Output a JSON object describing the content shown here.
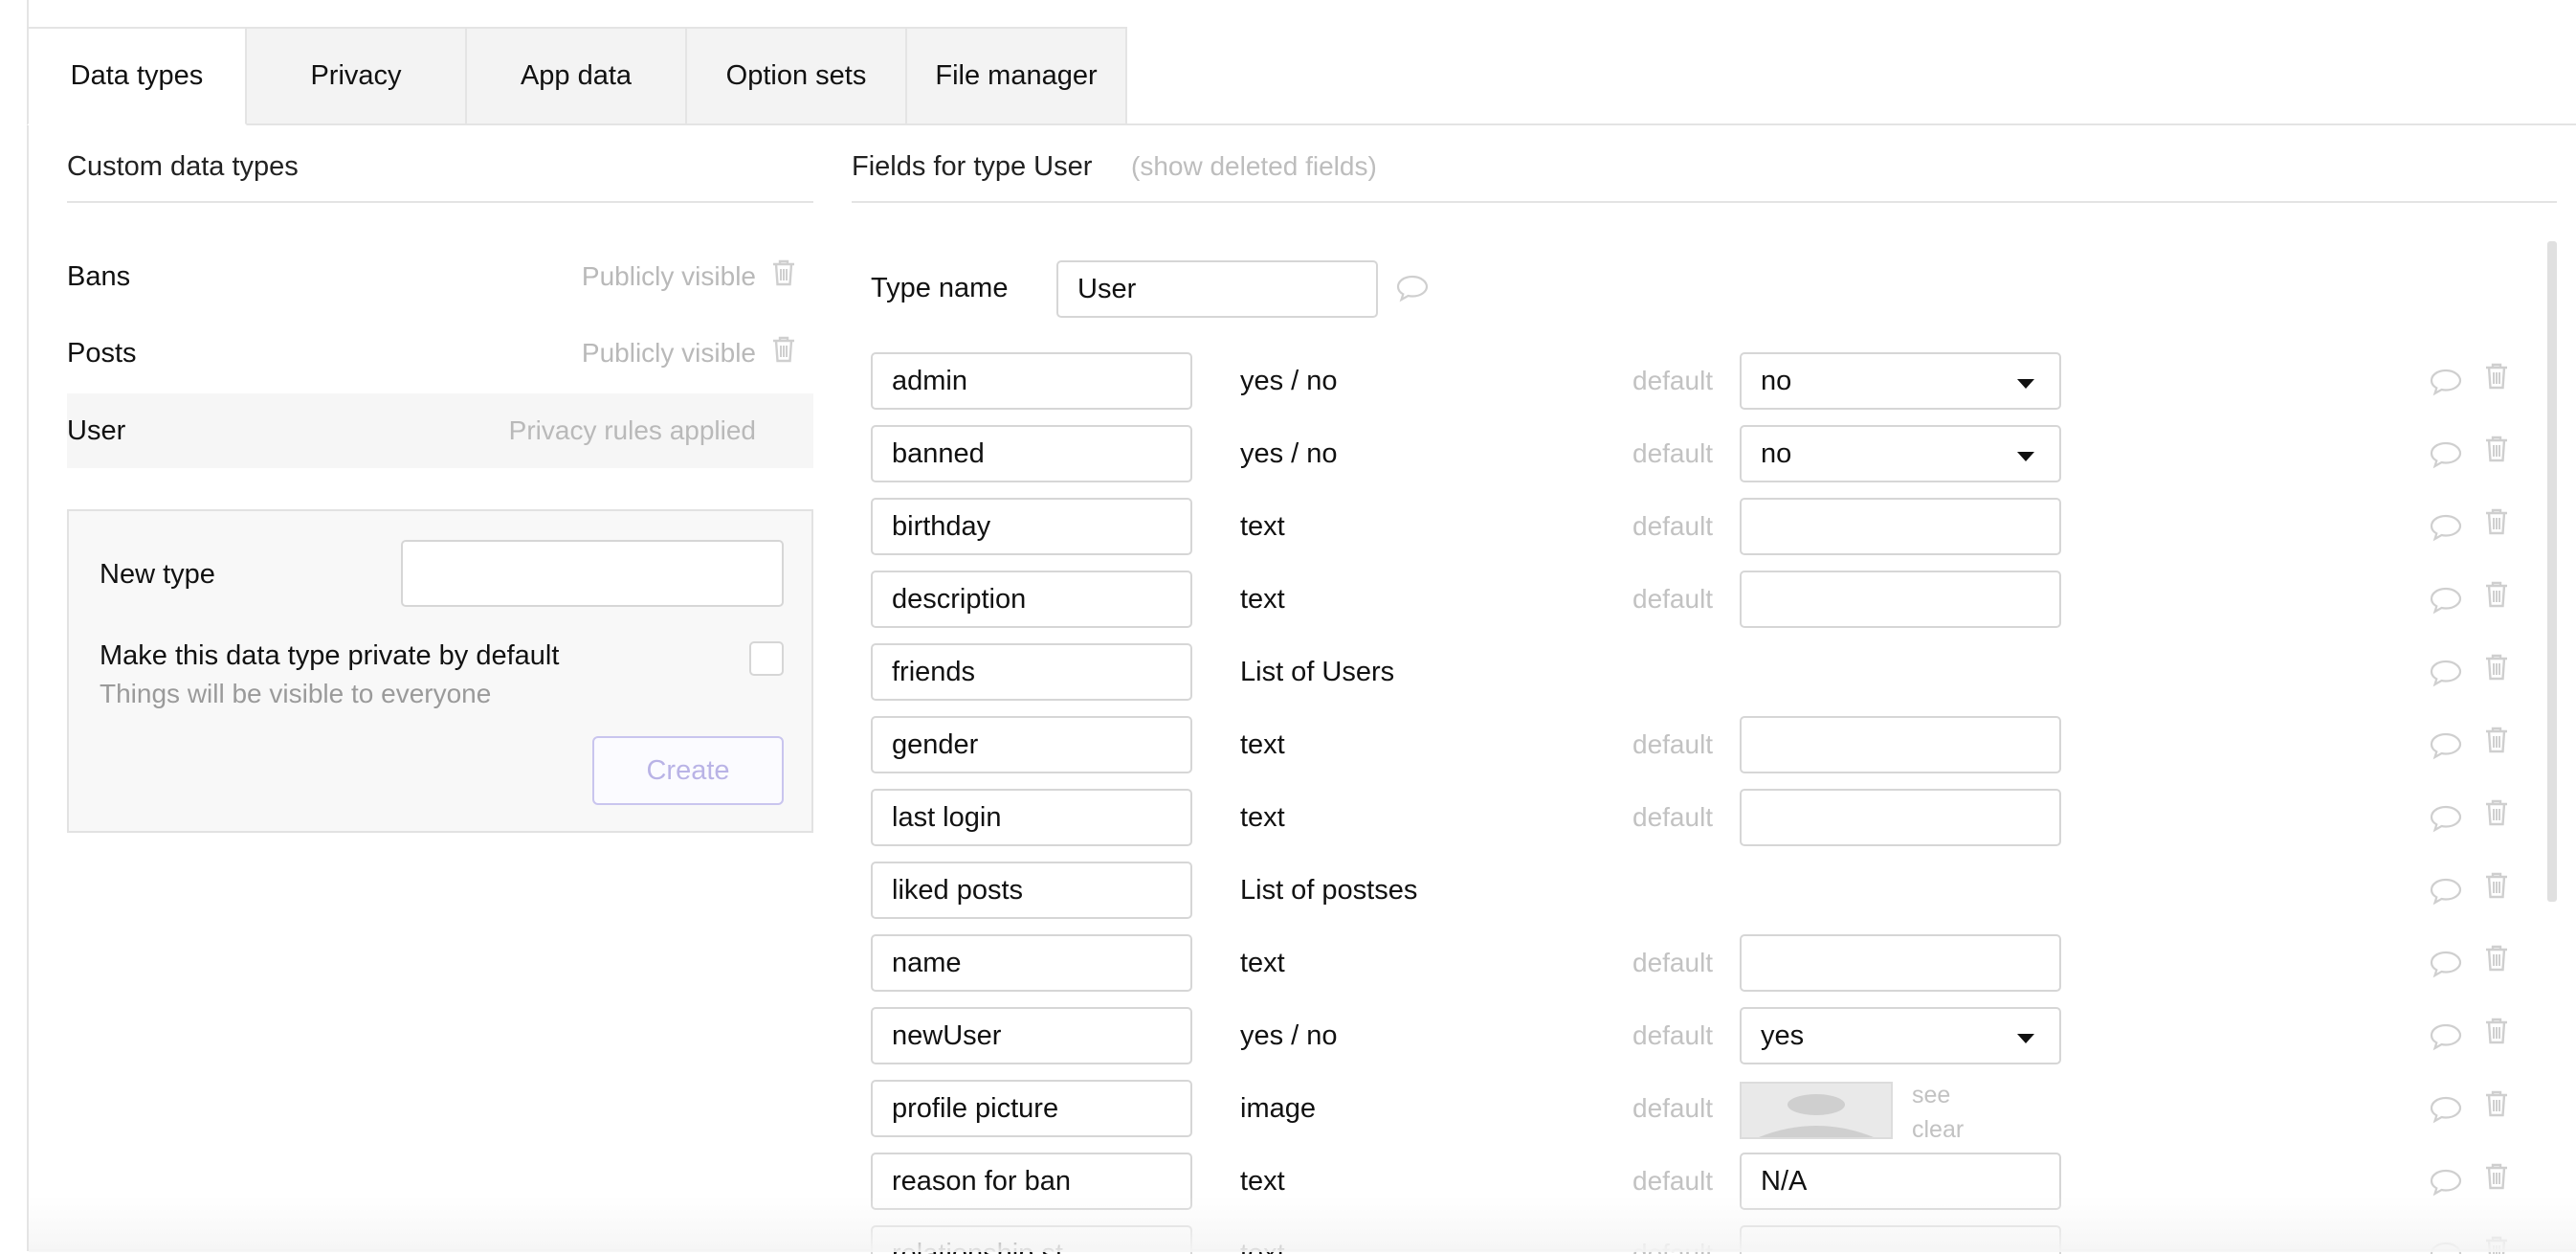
{
  "tabs": [
    "Data types",
    "Privacy",
    "App data",
    "Option sets",
    "File manager"
  ],
  "left": {
    "heading": "Custom data types",
    "types": [
      {
        "name": "Bans",
        "status": "Publicly visible",
        "deletable": true
      },
      {
        "name": "Posts",
        "status": "Publicly visible",
        "deletable": true
      },
      {
        "name": "User",
        "status": "Privacy rules applied",
        "deletable": false
      }
    ],
    "new_type": {
      "label": "New type",
      "private_label": "Make this data type private by default",
      "private_sub": "Things will be visible to everyone",
      "create_label": "Create"
    }
  },
  "right": {
    "heading": "Fields for type User",
    "show_deleted": "(show deleted fields)",
    "type_name_label": "Type name",
    "type_name_value": "User",
    "fields": [
      {
        "name": "admin",
        "type": "yes / no",
        "default_label": "default",
        "default": "no",
        "kind": "select"
      },
      {
        "name": "banned",
        "type": "yes / no",
        "default_label": "default",
        "default": "no",
        "kind": "select"
      },
      {
        "name": "birthday",
        "type": "text",
        "default_label": "default",
        "default": "",
        "kind": "text"
      },
      {
        "name": "description",
        "type": "text",
        "default_label": "default",
        "default": "",
        "kind": "text"
      },
      {
        "name": "friends",
        "type": "List of Users",
        "default_label": "",
        "default": "",
        "kind": "none"
      },
      {
        "name": "gender",
        "type": "text",
        "default_label": "default",
        "default": "",
        "kind": "text"
      },
      {
        "name": "last login",
        "type": "text",
        "default_label": "default",
        "default": "",
        "kind": "text"
      },
      {
        "name": "liked posts",
        "type": "List of postses",
        "default_label": "",
        "default": "",
        "kind": "none"
      },
      {
        "name": "name",
        "type": "text",
        "default_label": "default",
        "default": "",
        "kind": "text"
      },
      {
        "name": "newUser",
        "type": "yes / no",
        "default_label": "default",
        "default": "yes",
        "kind": "select"
      },
      {
        "name": "profile picture",
        "type": "image",
        "default_label": "default",
        "default": "",
        "kind": "image",
        "see": "see",
        "clear": "clear"
      },
      {
        "name": "reason for ban",
        "type": "text",
        "default_label": "default",
        "default": "N/A",
        "kind": "text"
      },
      {
        "name": "relationship st...",
        "type": "text",
        "default_label": "default",
        "default": "",
        "kind": "text"
      }
    ]
  }
}
